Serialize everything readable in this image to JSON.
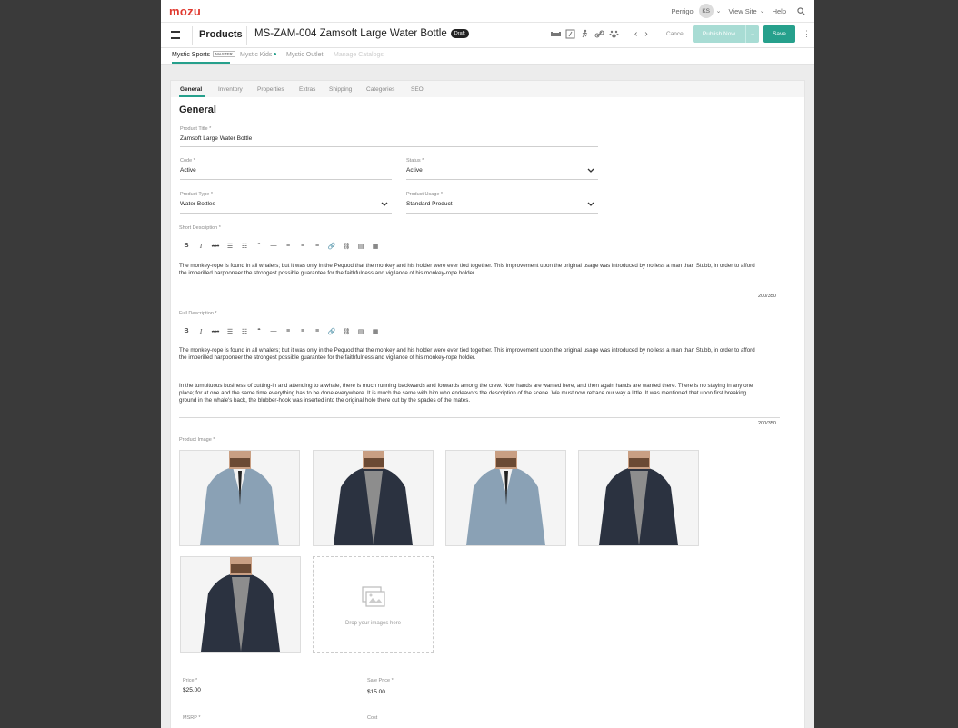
{
  "brand": {
    "logo": "mozu",
    "accent": "#26a08c",
    "logo_color": "#e0392f"
  },
  "topbar": {
    "user": "Perrigo",
    "initials": "KS",
    "view_site": "View Site",
    "help": "Help"
  },
  "header": {
    "section": "Products",
    "title": "MS-ZAM-004 Zamsoft Large Water Bottle",
    "status_badge": "Draft",
    "cancel": "Cancel",
    "publish": "Publish Now",
    "save": "Save"
  },
  "sites": [
    {
      "label": "Mystic Sports",
      "badge": "MASTER"
    },
    {
      "label": "Mystic Kids"
    },
    {
      "label": "Mystic Outlet"
    },
    {
      "label": "Manage Catalogs"
    }
  ],
  "tabs": [
    "General",
    "Inventory",
    "Properties",
    "Extras",
    "Shipping",
    "Categories",
    "SEO"
  ],
  "form": {
    "heading": "General",
    "product_title": {
      "label": "Product Title *",
      "value": "Zamsoft Large Water Bottle"
    },
    "code": {
      "label": "Code *",
      "value": "Active"
    },
    "status": {
      "label": "Status *",
      "value": "Active"
    },
    "product_type": {
      "label": "Product Type *",
      "value": "Water Bottles"
    },
    "product_usage": {
      "label": "Product Usage *",
      "value": "Standard Product"
    },
    "short_description": {
      "label": "Short Description *",
      "text": "The monkey-rope is found in all whalers; but it was only in the Pequod that the monkey and his holder were ever tied together. This improvement upon the original usage was introduced by no less a man than Stubb, in order to afford the imperilled harpooneer the strongest possible guarantee for the faithfulness and vigilance of his monkey-rope holder.",
      "counter": "200/350"
    },
    "full_description": {
      "label": "Full Description *",
      "p1": "The monkey-rope is found in all whalers; but it was only in the Pequod that the monkey and his holder were ever tied together. This improvement upon the original usage was introduced by no less a man than Stubb, in order to afford the imperilled harpooneer the strongest possible guarantee for the faithfulness and vigilance of his monkey-rope holder.",
      "p2": "In the tumultuous business of cutting-in and attending to a whale, there is much running backwards and forwards among the crew. Now hands are wanted here, and then again hands are wanted there. There is no staying in any one place; for at one and the same time everything has to be done everywhere. It is much the same with him who endeavors the description of the scene. We must now retrace our way a little. It was mentioned that upon first breaking ground in the whale's back, the blubber-hook was inserted into the original hole there cut by the spades of the mates.",
      "counter": "200/350"
    },
    "product_image": {
      "label": "Product Image *",
      "drop_text": "Drop your  images here"
    },
    "price": {
      "label": "Price *",
      "value": "$25.00"
    },
    "sale_price": {
      "label": "Sale Price *",
      "value": "$15.00"
    },
    "msrp": {
      "label": "MSRP *"
    },
    "cost": {
      "label": "Cost"
    }
  }
}
